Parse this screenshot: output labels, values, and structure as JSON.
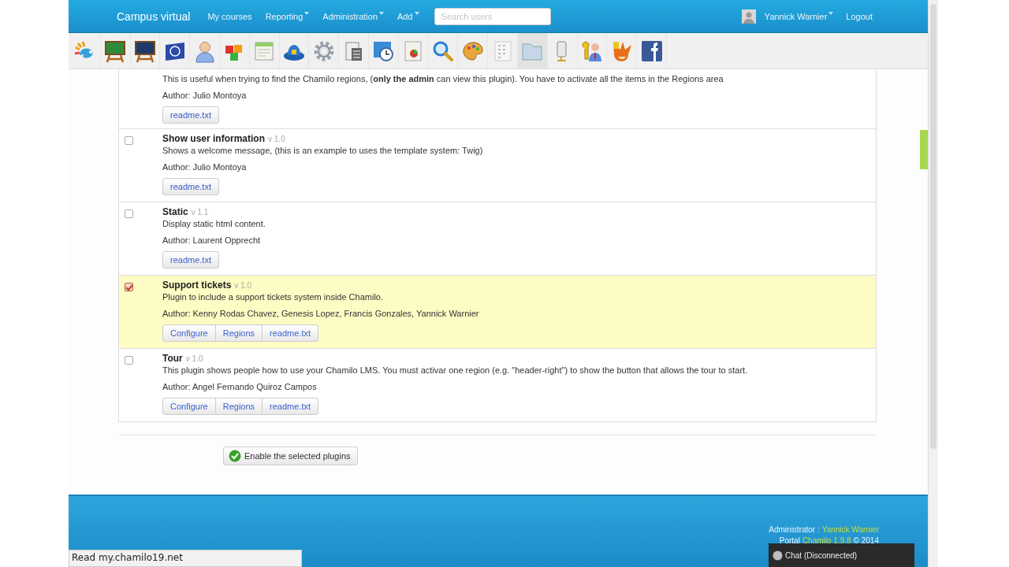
{
  "header": {
    "brand": "Campus virtual",
    "nav": [
      {
        "label": "My courses",
        "dropdown": false
      },
      {
        "label": "Reporting",
        "dropdown": true
      },
      {
        "label": "Administration",
        "dropdown": true
      },
      {
        "label": "Add",
        "dropdown": true
      }
    ],
    "search": {
      "placeholder": "Search users"
    },
    "user": {
      "name": "Yannick Warnier",
      "dropdown": true
    },
    "logout": "Logout"
  },
  "plugins": [
    {
      "description": "This is useful when trying to find the Chamilo regions, (**only the admin** can view this plugin). You have to activate all the items in the Regions area",
      "author": "Author: Julio Montoya",
      "actions": [
        "readme.txt"
      ]
    },
    {
      "name": "Show user information",
      "version": "v 1.0",
      "checked": false,
      "description": "Shows a welcome message, (this is an example to uses the template system: Twig)",
      "author": "Author: Julio Montoya",
      "actions": [
        "readme.txt"
      ]
    },
    {
      "name": "Static",
      "version": "v 1.1",
      "checked": false,
      "description": "Display static html content.",
      "author": "Author: Laurent Opprecht",
      "actions": [
        "readme.txt"
      ]
    },
    {
      "name": "Support tickets",
      "version": "v 1.0",
      "checked": true,
      "description": "Plugin to include a support tickets system inside Chamilo.",
      "author": "Author: Kenny Rodas Chavez, Genesis Lopez, Francis Gonzales, Yannick Warnier",
      "actions": [
        "Configure",
        "Regions",
        "readme.txt"
      ]
    },
    {
      "name": "Tour",
      "version": "v 1.0",
      "checked": false,
      "description": "This plugin shows people how to use your Chamilo LMS. You must activar one region (e.g. \"header-right\") to show the button that allows the tour to start.",
      "author": "Author: Angel Fernando Quiroz Campos",
      "actions": [
        "Configure",
        "Regions",
        "readme.txt"
      ]
    }
  ],
  "submit": "Enable the selected plugins",
  "footer": {
    "admin_label": "Administrator :",
    "admin_name": "Yannick Warnier",
    "portal_label": "Portal",
    "portal_link": "Chamilo 1.9.8",
    "copyright": "© 2014"
  },
  "status_bar": "Read my.chamilo19.net",
  "chat": "Chat (Disconnected)"
}
